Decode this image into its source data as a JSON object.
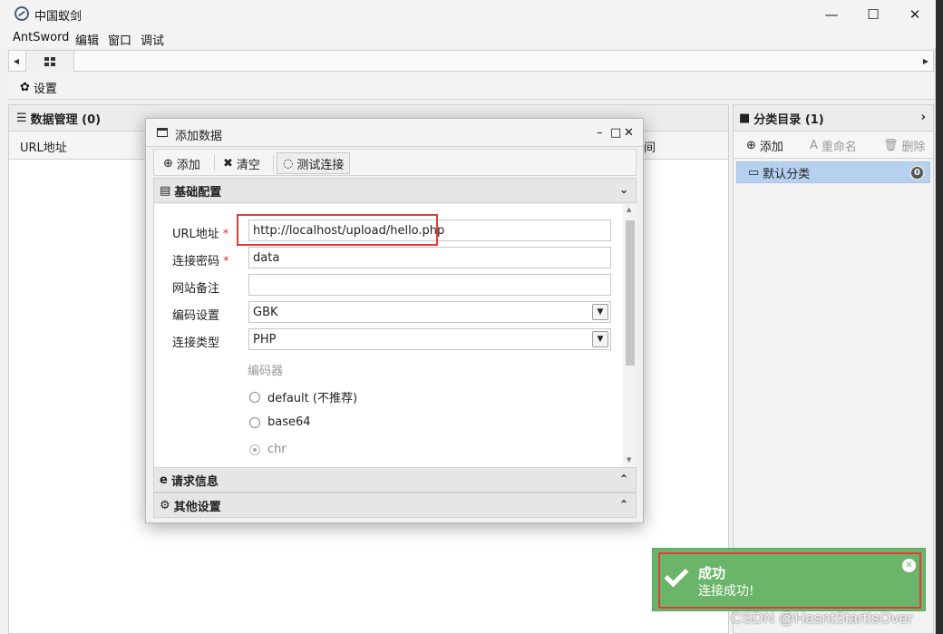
{
  "window": {
    "title": "中国蚁剑"
  },
  "menu": [
    "AntSword",
    "编辑",
    "窗口",
    "调试"
  ],
  "toolbar": {
    "settings_label": "设置"
  },
  "data_panel": {
    "title": "数据管理 (0)",
    "columns": [
      "URL地址",
      "间"
    ]
  },
  "category_panel": {
    "title": "分类目录 (1)",
    "actions": {
      "add": "添加",
      "rename": "重命名",
      "delete": "删除"
    },
    "items": [
      {
        "label": "默认分类",
        "count": "0"
      }
    ]
  },
  "dialog": {
    "title": "添加数据",
    "toolbar": {
      "add": "添加",
      "clear": "清空",
      "test": "测试连接"
    },
    "sections": {
      "basic": "基础配置",
      "request": "请求信息",
      "other": "其他设置"
    },
    "fields": {
      "url_label": "URL地址",
      "url_value": "http://localhost/upload/hello.php",
      "password_label": "连接密码",
      "password_value": "data",
      "note_label": "网站备注",
      "note_value": "",
      "encoding_label": "编码设置",
      "encoding_value": "GBK",
      "type_label": "连接类型",
      "type_value": "PHP",
      "required_mark": "*"
    },
    "encoder": {
      "label": "编码器",
      "options": [
        "default (不推荐)",
        "base64",
        "chr"
      ],
      "selected": "chr"
    }
  },
  "toast": {
    "title": "成功",
    "message": "连接成功!"
  },
  "watermark": "CSDN @HasntStartIsOver",
  "colors": {
    "toast_bg": "#6ab56a",
    "highlight": "#e03c3c",
    "selection": "#b5d1ef"
  }
}
